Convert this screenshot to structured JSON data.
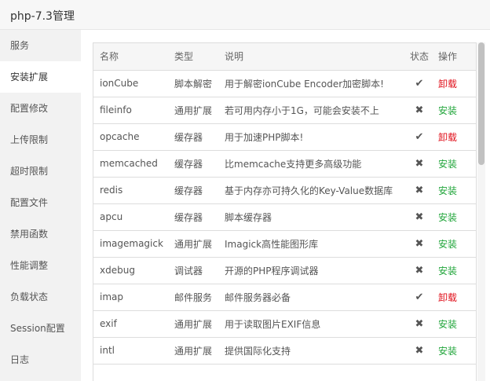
{
  "window": {
    "title": "php-7.3管理"
  },
  "sidebar": {
    "items": [
      {
        "label": "服务"
      },
      {
        "label": "安装扩展"
      },
      {
        "label": "配置修改"
      },
      {
        "label": "上传限制"
      },
      {
        "label": "超时限制"
      },
      {
        "label": "配置文件"
      },
      {
        "label": "禁用函数"
      },
      {
        "label": "性能调整"
      },
      {
        "label": "负载状态"
      },
      {
        "label": "Session配置"
      },
      {
        "label": "日志"
      }
    ],
    "active_index": 1
  },
  "table": {
    "headers": {
      "name": "名称",
      "type": "类型",
      "desc": "说明",
      "status": "状态",
      "action": "操作"
    },
    "rows": [
      {
        "name": "ionCube",
        "type": "脚本解密",
        "desc": "用于解密ionCube Encoder加密脚本!",
        "status": "✔",
        "installed": true,
        "action": "卸载"
      },
      {
        "name": "fileinfo",
        "type": "通用扩展",
        "desc": "若可用内存小于1G，可能会安装不上",
        "status": "✖",
        "installed": false,
        "action": "安装"
      },
      {
        "name": "opcache",
        "type": "缓存器",
        "desc": "用于加速PHP脚本!",
        "status": "✔",
        "installed": true,
        "action": "卸载"
      },
      {
        "name": "memcached",
        "type": "缓存器",
        "desc": "比memcache支持更多高级功能",
        "status": "✖",
        "installed": false,
        "action": "安装"
      },
      {
        "name": "redis",
        "type": "缓存器",
        "desc": "基于内存亦可持久化的Key-Value数据库",
        "status": "✖",
        "installed": false,
        "action": "安装"
      },
      {
        "name": "apcu",
        "type": "缓存器",
        "desc": "脚本缓存器",
        "status": "✖",
        "installed": false,
        "action": "安装"
      },
      {
        "name": "imagemagick",
        "type": "通用扩展",
        "desc": "Imagick高性能图形库",
        "status": "✖",
        "installed": false,
        "action": "安装"
      },
      {
        "name": "xdebug",
        "type": "调试器",
        "desc": "开源的PHP程序调试器",
        "status": "✖",
        "installed": false,
        "action": "安装"
      },
      {
        "name": "imap",
        "type": "邮件服务",
        "desc": "邮件服务器必备",
        "status": "✔",
        "installed": true,
        "action": "卸载"
      },
      {
        "name": "exif",
        "type": "通用扩展",
        "desc": "用于读取图片EXIF信息",
        "status": "✖",
        "installed": false,
        "action": "安装"
      },
      {
        "name": "intl",
        "type": "通用扩展",
        "desc": "提供国际化支持",
        "status": "✖",
        "installed": false,
        "action": "安装"
      }
    ]
  },
  "colors": {
    "install": "#20a53a",
    "uninstall": "#e0101b"
  }
}
